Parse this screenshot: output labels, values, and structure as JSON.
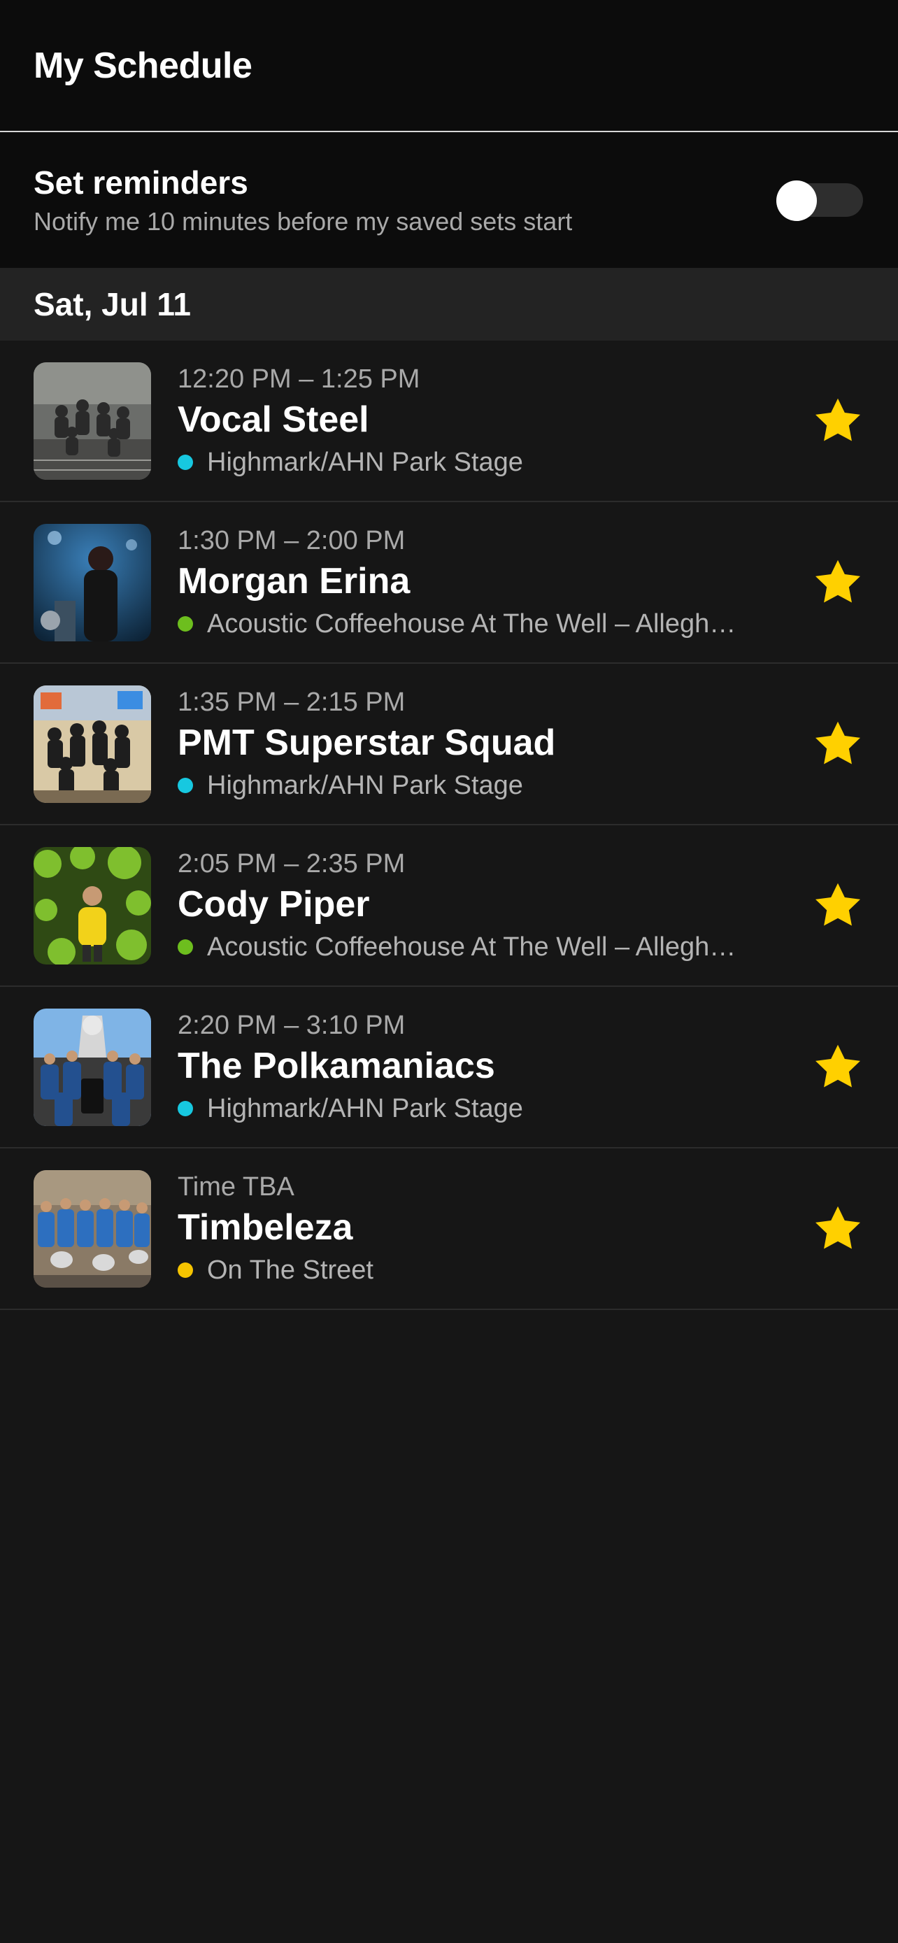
{
  "header": {
    "title": "My Schedule"
  },
  "reminders": {
    "title": "Set reminders",
    "subtitle": "Notify me 10 minutes before my saved sets start",
    "enabled": false
  },
  "day": {
    "label": "Sat, Jul 11"
  },
  "colors": {
    "star": "#FFD000",
    "park_stage": "#17C8E0",
    "coffeehouse": "#6DBE1E",
    "street": "#F5C400"
  },
  "sets": [
    {
      "time": "12:20 PM – 1:25 PM",
      "name": "Vocal Steel",
      "stage": "Highmark/AHN Park Stage",
      "stage_color": "#17C8E0",
      "starred": true,
      "icon": "star-icon"
    },
    {
      "time": "1:30 PM – 2:00 PM",
      "name": "Morgan Erina",
      "stage": "Acoustic Coffeehouse At The Well – Allegh…",
      "stage_color": "#6DBE1E",
      "starred": true,
      "icon": "star-icon"
    },
    {
      "time": "1:35 PM – 2:15 PM",
      "name": "PMT Superstar Squad",
      "stage": "Highmark/AHN Park Stage",
      "stage_color": "#17C8E0",
      "starred": true,
      "icon": "star-icon"
    },
    {
      "time": "2:05 PM – 2:35 PM",
      "name": "Cody Piper",
      "stage": "Acoustic Coffeehouse At The Well – Allegh…",
      "stage_color": "#6DBE1E",
      "starred": true,
      "icon": "star-icon"
    },
    {
      "time": "2:20 PM – 3:10 PM",
      "name": "The Polkamaniacs",
      "stage": "Highmark/AHN Park Stage",
      "stage_color": "#17C8E0",
      "starred": true,
      "icon": "star-icon"
    },
    {
      "time": "Time TBA",
      "name": "Timbeleza",
      "stage": "On The Street",
      "stage_color": "#F5C400",
      "starred": true,
      "icon": "star-icon"
    }
  ]
}
